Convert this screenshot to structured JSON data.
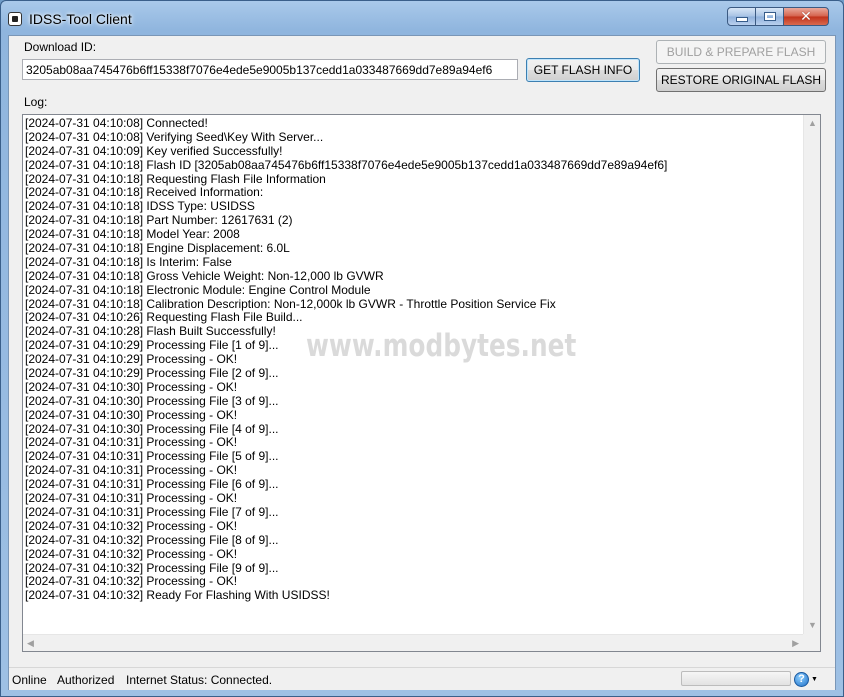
{
  "window": {
    "title": "IDSS-Tool Client"
  },
  "download": {
    "label": "Download ID:",
    "value": "3205ab08aa745476b6ff15338f7076e4ede5e9005b137cedd1a033487669dd7e89a94ef6"
  },
  "buttons": {
    "get_flash_info": "GET FLASH INFO",
    "build_prepare_flash": "BUILD & PREPARE FLASH",
    "restore_original_flash": "RESTORE ORIGINAL FLASH"
  },
  "log": {
    "label": "Log:",
    "lines": [
      "[2024-07-31 04:10:08] Connected!",
      "[2024-07-31 04:10:08] Verifying Seed\\Key With Server...",
      "[2024-07-31 04:10:09] Key verified Successfully!",
      "[2024-07-31 04:10:18] Flash ID [3205ab08aa745476b6ff15338f7076e4ede5e9005b137cedd1a033487669dd7e89a94ef6]",
      "[2024-07-31 04:10:18] Requesting Flash File Information",
      "[2024-07-31 04:10:18] Received Information:",
      "[2024-07-31 04:10:18] IDSS Type: USIDSS",
      "[2024-07-31 04:10:18] Part Number: 12617631 (2)",
      "[2024-07-31 04:10:18] Model Year: 2008",
      "[2024-07-31 04:10:18] Engine Displacement: 6.0L",
      "[2024-07-31 04:10:18] Is Interim: False",
      "[2024-07-31 04:10:18] Gross Vehicle Weight: Non-12,000 lb GVWR",
      "[2024-07-31 04:10:18] Electronic Module: Engine Control Module",
      "[2024-07-31 04:10:18] Calibration Description: Non-12,000k lb GVWR - Throttle Position Service Fix",
      "[2024-07-31 04:10:26] Requesting Flash File Build...",
      "[2024-07-31 04:10:28] Flash Built Successfully!",
      "[2024-07-31 04:10:29] Processing File [1 of 9]...",
      "[2024-07-31 04:10:29] Processing - OK!",
      "[2024-07-31 04:10:29] Processing File [2 of 9]...",
      "[2024-07-31 04:10:30] Processing - OK!",
      "[2024-07-31 04:10:30] Processing File [3 of 9]...",
      "[2024-07-31 04:10:30] Processing - OK!",
      "[2024-07-31 04:10:30] Processing File [4 of 9]...",
      "[2024-07-31 04:10:31] Processing - OK!",
      "[2024-07-31 04:10:31] Processing File [5 of 9]...",
      "[2024-07-31 04:10:31] Processing - OK!",
      "[2024-07-31 04:10:31] Processing File [6 of 9]...",
      "[2024-07-31 04:10:31] Processing - OK!",
      "[2024-07-31 04:10:31] Processing File [7 of 9]...",
      "[2024-07-31 04:10:32] Processing - OK!",
      "[2024-07-31 04:10:32] Processing File [8 of 9]...",
      "[2024-07-31 04:10:32] Processing - OK!",
      "[2024-07-31 04:10:32] Processing File [9 of 9]...",
      "[2024-07-31 04:10:32] Processing - OK!",
      "[2024-07-31 04:10:32] Ready For Flashing With USIDSS!"
    ]
  },
  "status": {
    "online": "Online",
    "authorized": "Authorized",
    "internet": "Internet Status: Connected.",
    "progress": 0
  },
  "icons": {
    "app": "app-icon",
    "minimize": "minimize-icon",
    "maximize": "maximize-icon",
    "close": "close-icon",
    "help": "help-icon"
  },
  "watermark": "www.modbytes.net"
}
